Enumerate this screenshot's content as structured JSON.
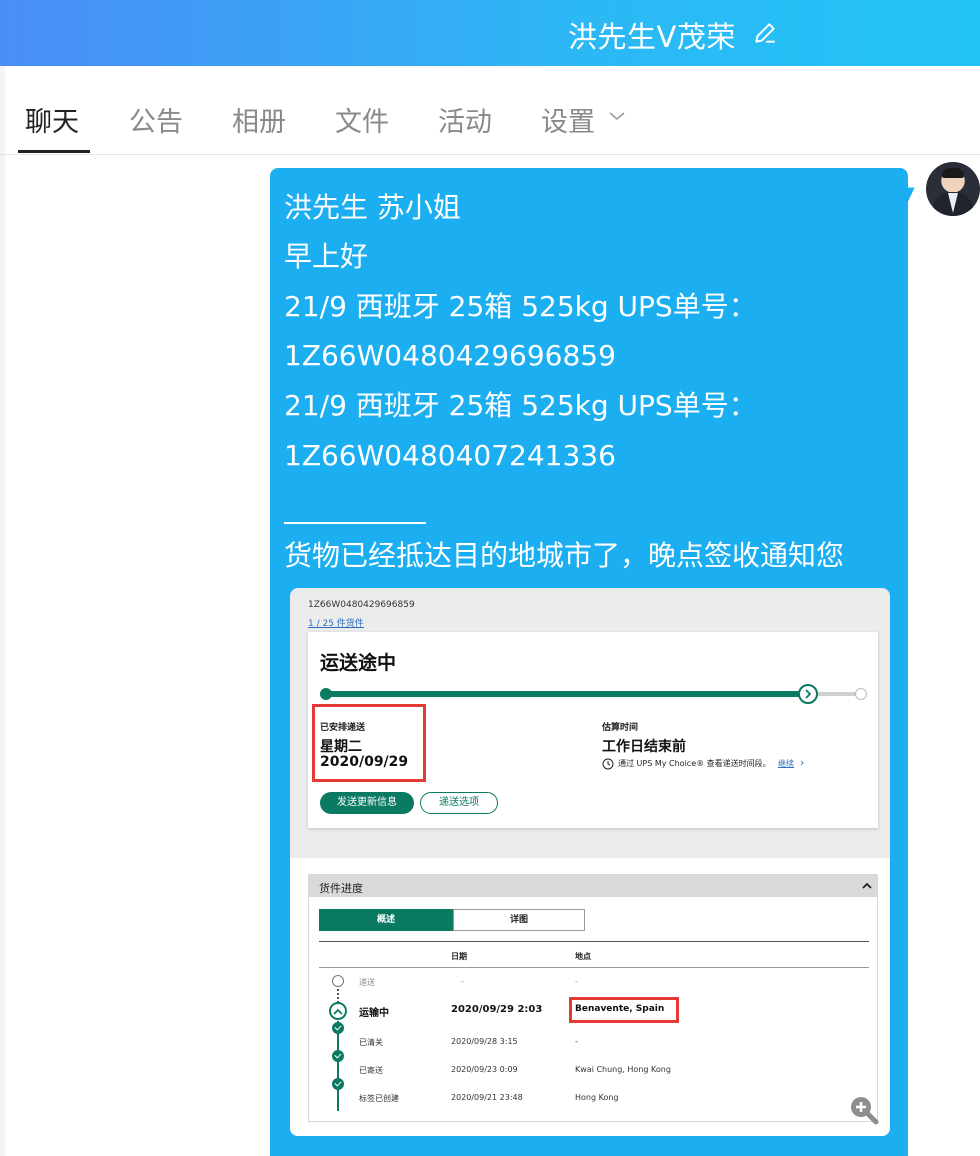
{
  "header": {
    "title": "洪先生V茂荣"
  },
  "tabs": [
    {
      "label": "聊天"
    },
    {
      "label": "公告"
    },
    {
      "label": "相册"
    },
    {
      "label": "文件"
    },
    {
      "label": "活动"
    },
    {
      "label": "设置"
    }
  ],
  "message": {
    "lines": [
      "洪先生 苏小姐",
      "早上好",
      "21/9 西班牙 25箱  525kg UPS单号：",
      "1Z66W0480429696859",
      "21/9 西班牙 25箱  525kg UPS单号：",
      "1Z66W0480407241336",
      "货物已经抵达目的地城市了，晚点签收通知您"
    ]
  },
  "shot": {
    "tracking_number": "1Z66W0480429696859",
    "package_link": "1 / 25 件货件",
    "status_title": "运送途中",
    "progress": 0.9,
    "scheduled": {
      "label": "已安排递送",
      "day": "星期二",
      "date": "2020/09/29"
    },
    "estimated": {
      "label": "估算时间",
      "value": "工作日结束前",
      "note": "通过 UPS My Choice® 查看递送时间段。",
      "link": "继续"
    },
    "buttons": {
      "send_update": "发送更新信息",
      "delivery_options": "递送选项"
    },
    "progress_panel": {
      "title": "货件进度",
      "segments": [
        "概述",
        "详图"
      ],
      "columns": [
        "日期",
        "地点"
      ],
      "rows": [
        {
          "status": "递送",
          "date": "-",
          "location": "-"
        },
        {
          "status": "运输中",
          "date": "2020/09/29  2:03",
          "location": "Benavente, Spain"
        },
        {
          "status": "已清关",
          "date": "2020/09/28  3:15",
          "location": "-"
        },
        {
          "status": "已寄送",
          "date": "2020/09/23  0:09",
          "location": "Kwai Chung, Hong Kong"
        },
        {
          "status": "标签已创建",
          "date": "2020/09/21  23:48",
          "location": "Hong Kong"
        }
      ]
    }
  },
  "colors": {
    "bubble": "#1baef1",
    "ups_green": "#0a7a63",
    "highlight": "#e53935"
  }
}
